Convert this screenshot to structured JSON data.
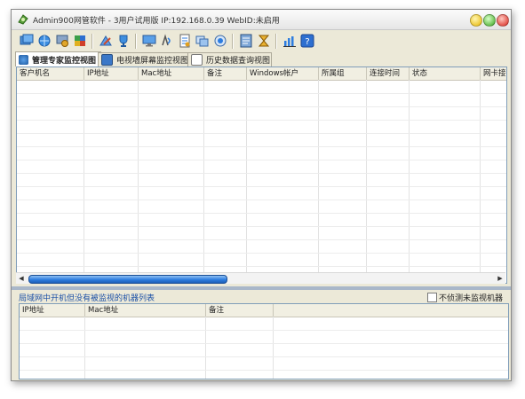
{
  "window": {
    "title": "Admin900网管软件 - 3用户试用版 IP:192.168.0.39 WebID:未启用"
  },
  "toolbar": {
    "buttons": [
      {
        "icon": "add-computer-icon"
      },
      {
        "icon": "globe-refresh-icon"
      },
      {
        "icon": "network-settings-icon"
      },
      {
        "icon": "puzzle-icon"
      },
      {
        "icon": "remote-control-icon"
      },
      {
        "icon": "trophy-icon"
      },
      {
        "icon": "monitor-icon"
      },
      {
        "icon": "broadcast-icon"
      },
      {
        "icon": "report-icon"
      },
      {
        "icon": "copy-windows-icon"
      },
      {
        "icon": "screen-capture-icon"
      },
      {
        "icon": "policy-settings-icon"
      },
      {
        "icon": "hourglass-icon"
      },
      {
        "icon": "chart-icon"
      },
      {
        "icon": "help-icon"
      }
    ]
  },
  "tabs": [
    {
      "label": "管理专家监控视图",
      "icon": "manager-view-icon",
      "active": true
    },
    {
      "label": "电视墙屏幕监控视图",
      "icon": "tv-wall-icon",
      "active": false
    },
    {
      "label": "历史数据查询视图",
      "icon": "history-query-icon",
      "active": false
    }
  ],
  "main_table": {
    "columns": [
      "客户机名",
      "IP地址",
      "Mac地址",
      "备注",
      "Windows帐户",
      "所属组",
      "连接时间",
      "状态",
      "网卡接"
    ]
  },
  "lower_panel": {
    "title": "局域网中开机但没有被监视的机器列表",
    "checkbox_label": "不侦测未监视机器",
    "checkbox_checked": false,
    "columns": [
      "IP地址",
      "Mac地址",
      "备注"
    ]
  },
  "colors": {
    "accent": "#2d7de0",
    "panel_title": "#1a4fa6",
    "window_bg": "#ece9d8"
  }
}
